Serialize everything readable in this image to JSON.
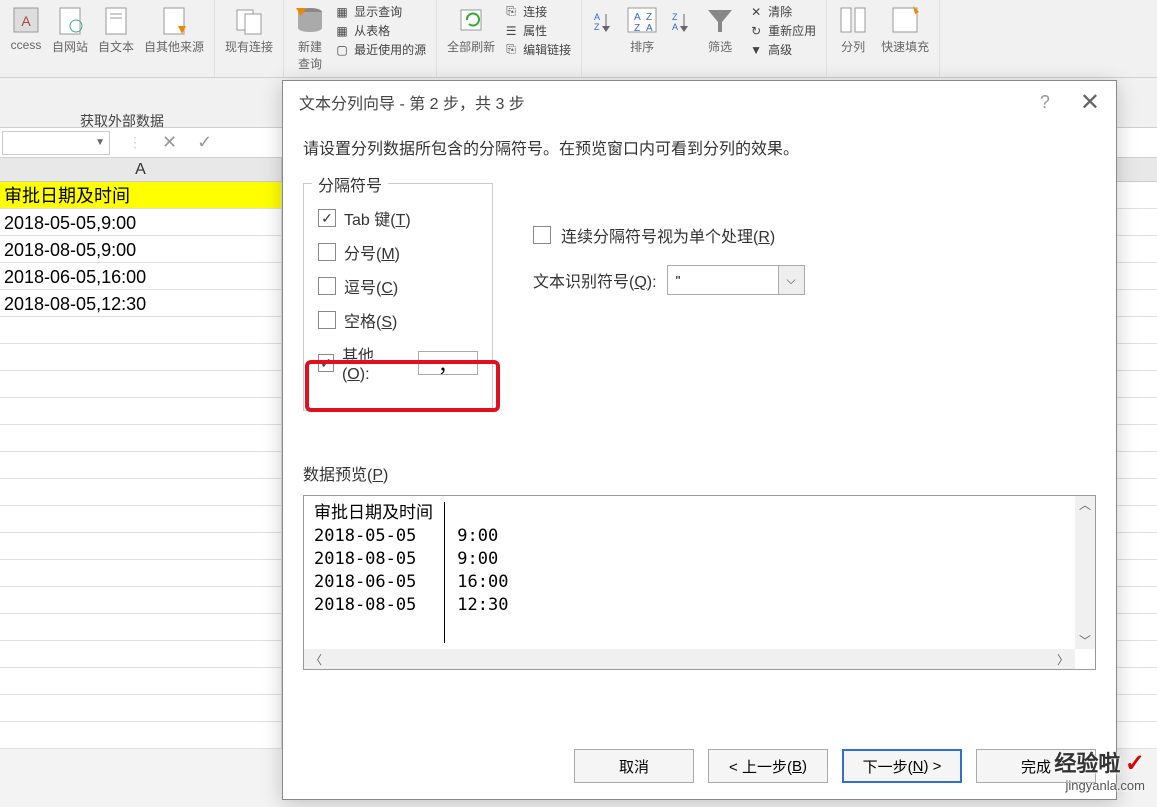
{
  "ribbon": {
    "group_data_label": "获取外部数据",
    "btn_access": "ccess",
    "btn_web": "自网站",
    "btn_text": "自文本",
    "btn_other": "自其他来源",
    "btn_existing": "现有连接",
    "btn_new_query": "新建",
    "btn_new_query2": "查询",
    "show_query": "显示查询",
    "from_table": "从表格",
    "recent_sources": "最近使用的源",
    "refresh_all": "全部刷新",
    "connections": "连接",
    "properties": "属性",
    "edit_links": "编辑链接",
    "sort": "排序",
    "filter": "筛选",
    "clear": "清除",
    "reapply": "重新应用",
    "advanced": "高级",
    "text_to_columns": "分列",
    "flash_fill": "快速填充"
  },
  "sheet": {
    "col_a": "A",
    "header": "审批日期及时间",
    "rows": [
      "2018-05-05,9:00",
      "2018-08-05,9:00",
      "2018-06-05,16:00",
      "2018-08-05,12:30"
    ]
  },
  "dialog": {
    "title": "文本分列向导 - 第 2 步，共 3 步",
    "instruction": "请设置分列数据所包含的分隔符号。在预览窗口内可看到分列的效果。",
    "delimiters_legend": "分隔符号",
    "tab_label": "Tab 键(T)",
    "semicolon_label": "分号(M)",
    "comma_label": "逗号(C)",
    "space_label": "空格(S)",
    "other_label": "其他(O):",
    "other_value": "，",
    "consecutive_label": "连续分隔符号视为单个处理(R)",
    "text_qualifier_label": "文本识别符号(Q):",
    "text_qualifier_value": "\"",
    "preview_label": "数据预览(P)",
    "preview_header": "审批日期及时间",
    "preview_rows": [
      {
        "c1": "2018-05-05",
        "c2": "9:00"
      },
      {
        "c1": "2018-08-05",
        "c2": "9:00"
      },
      {
        "c1": "2018-06-05",
        "c2": "16:00"
      },
      {
        "c1": "2018-08-05",
        "c2": "12:30"
      }
    ],
    "btn_cancel": "取消",
    "btn_back": "< 上一步(B)",
    "btn_next": "下一步(N) >",
    "btn_finish": "完成"
  },
  "watermark": {
    "title": "经验啦",
    "url": "jingyanla.com"
  }
}
